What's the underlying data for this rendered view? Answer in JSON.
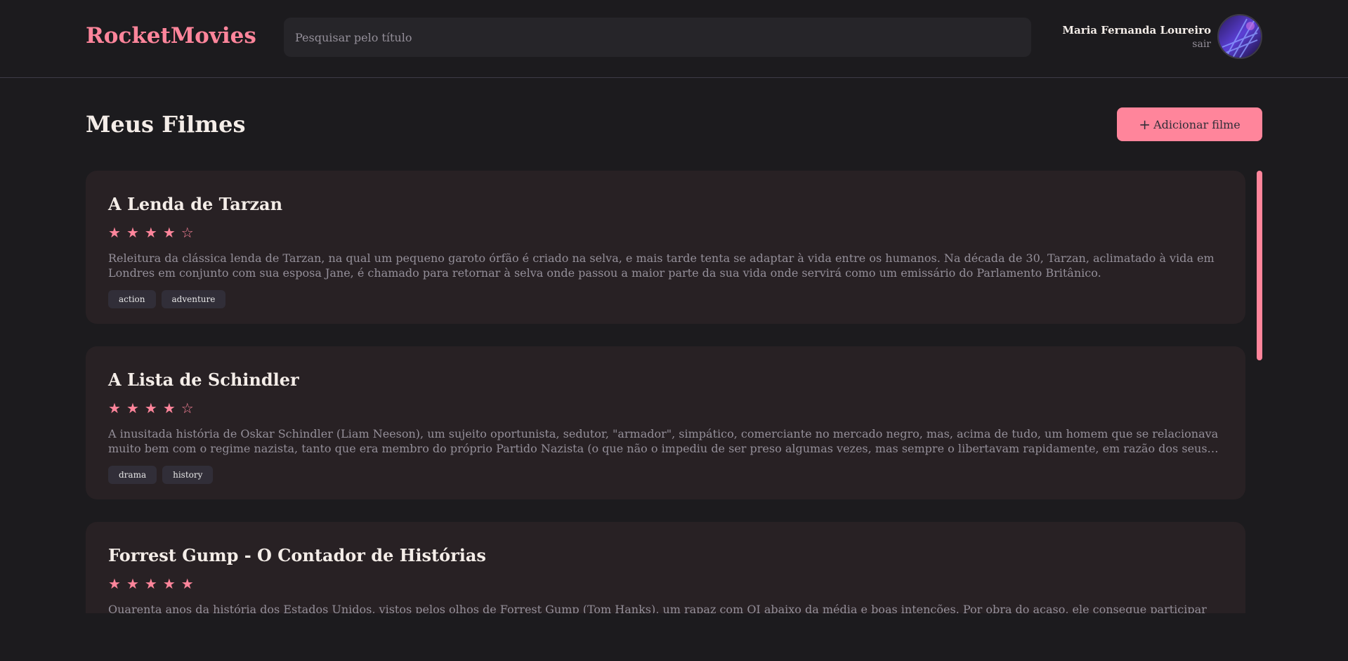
{
  "header": {
    "logo": "RocketMovies",
    "search_placeholder": "Pesquisar pelo título",
    "user_name": "Maria Fernanda Loureiro",
    "logout_label": "sair"
  },
  "main": {
    "title": "Meus Filmes",
    "add_button_label": "Adicionar filme",
    "movies": [
      {
        "title": "A Lenda de Tarzan",
        "rating": 4,
        "description": "Releitura da clássica lenda de Tarzan, na qual um pequeno garoto órfão é criado na selva, e mais tarde tenta se adaptar à vida entre os humanos. Na década de 30, Tarzan, aclimatado à vida em Londres em conjunto com sua esposa Jane, é chamado para retornar à selva onde passou a maior parte da sua vida onde servirá como um emissário do Parlamento Britânico.",
        "tags": [
          "action",
          "adventure"
        ]
      },
      {
        "title": "A Lista de Schindler",
        "rating": 4,
        "description": "A inusitada história de Oskar Schindler (Liam Neeson), um sujeito oportunista, sedutor, \"armador\", simpático, comerciante no mercado negro, mas, acima de tudo, um homem que se relacionava muito bem com o regime nazista, tanto que era membro do próprio Partido Nazista (o que não o impediu de ser preso algumas vezes, mas sempre o libertavam rapidamente, em razão dos seus contatos). No entanto, apesar dos se...",
        "tags": [
          "drama",
          "history"
        ]
      },
      {
        "title": "Forrest Gump - O Contador de Histórias",
        "rating": 5,
        "description": "Quarenta anos da história dos Estados Unidos, vistos pelos olhos de Forrest Gump (Tom Hanks), um rapaz com QI abaixo da média e boas intenções. Por obra do acaso, ele consegue participar de momentos",
        "tags": []
      }
    ]
  },
  "colors": {
    "accent": "#ff859b",
    "background": "#1c1b1e",
    "card": "#282124",
    "muted_text": "#948f99"
  },
  "icons": {
    "star_filled": "star-icon",
    "star_empty": "star-outline-icon",
    "add": "plus-icon"
  }
}
